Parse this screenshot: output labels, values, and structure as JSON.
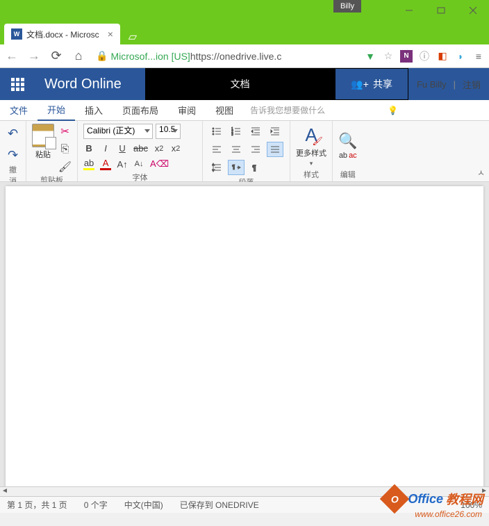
{
  "window": {
    "profile": "Billy"
  },
  "browser": {
    "tab_title": "文档.docx - Microsc",
    "tab_app_glyph": "W",
    "url_origin": "Microsof...ion [US]",
    "url_rest": " https://onedrive.live.c"
  },
  "header": {
    "app_name": "Word Online",
    "doc_title": "文档",
    "share_label": "共享",
    "user": "Fu Billy",
    "signout": "注销"
  },
  "ribbon_tabs": {
    "file": "文件",
    "home": "开始",
    "insert": "插入",
    "layout": "页面布局",
    "review": "审阅",
    "view": "视图",
    "tell_me": "告诉我您想要做什么"
  },
  "ribbon": {
    "undo_label": "撤消",
    "clipboard": {
      "paste": "粘贴",
      "label": "剪贴板"
    },
    "font": {
      "name": "Calibri (正文)",
      "size": "10.5",
      "label": "字体"
    },
    "para": {
      "label": "段落"
    },
    "styles": {
      "more": "更多样式",
      "label": "样式"
    },
    "edit": {
      "label": "编辑"
    }
  },
  "status": {
    "pages": "第 1 页，共 1 页",
    "words": "0 个字",
    "lang": "中文(中国)",
    "save": "已保存到 ONEDRIVE",
    "zoom": "100%"
  },
  "watermark": {
    "t1": "Office",
    "t2": "教程网",
    "url": "www.office26.com"
  }
}
